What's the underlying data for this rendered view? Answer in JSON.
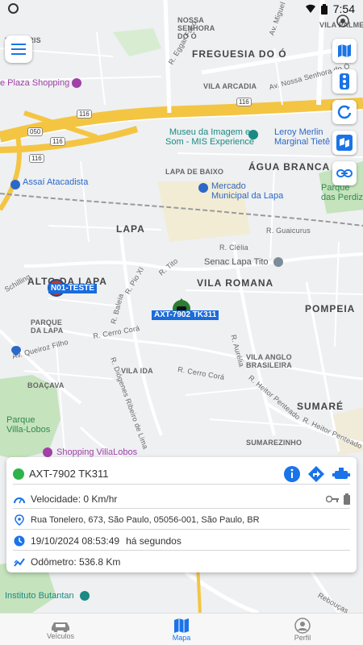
{
  "status_bar": {
    "time": "7:54"
  },
  "map": {
    "labels": {
      "freguesia": "FREGUESIA DO Ó",
      "agua_branca": "ÁGUA BRANCA",
      "lapa": "LAPA",
      "lapa_de_baixo": "LAPA DE BAIXO",
      "alto_da_lapa": "ALTO DA LAPA",
      "vila_romana": "VILA ROMANA",
      "pompeia": "POMPEIA",
      "parque_da_lapa": "PARQUE\nDA LAPA",
      "vila_ida": "VILA IDA",
      "vila_anglo": "VILA ANGLO\nBRASILEIRA",
      "boacava": "BOAÇAVA",
      "sumare": "SUMARÉ",
      "sumarezinho": "SUMAREZINHO",
      "vila_palmeira": "VILA PALME",
      "vila_arcadia": "VILA ARCADIA",
      "nossa_senhora": "NOSSA\nSENHORA\nDO Ó",
      "jardim_iris": "RDIM IRIS",
      "plaza_shopping": "e Plaza Shopping",
      "museu": "Museu da Imagem e\nSom - MIS Experience",
      "leroy": "Leroy Merlin\nMarginal Tietê",
      "assai": "Assaí Atacadista",
      "mercado": "Mercado\nMunicipal da Lapa",
      "senac": "Senac Lapa Tito",
      "parque_perdizes": "Parque\ndas Perdiz",
      "parque_villa_lobos": "Parque\nVilla-Lobos",
      "shopping_villalobos": "Shopping VillaLobos",
      "instituto": "Instituto Butantan",
      "rua_clelia": "R. Clélia",
      "rua_guaicurus": "R. Guaicurus",
      "rua_tito": "R. Tito",
      "rua_pio_xi": "R. Pio XI",
      "rua_cerro_cora": "R. Cerro Corá",
      "rua_cerro_cora2": "R. Cerro Corá",
      "rua_queiroz": "Av. Queiroz Filho",
      "rua_heitor": "R. Heitor Penteado",
      "rua_aurelia": "R. Aurélia",
      "rua_diogenes": "R. Diógenes Ribeiro de Lima",
      "rua_bauru": "R. Baleia",
      "rua_schilling": "Schilling",
      "rua_rebouças": "Rebouças",
      "rua_eggar": "R. Eggar Faco",
      "av_miguel": "Av. Miguel",
      "rua_nossa_senhora": "Av. Nossa Senhora do Ó",
      "rua_heitor2": "R. Heitor Penteado",
      "shield_116a": "116",
      "shield_116b": "116",
      "shield_050": "050",
      "shield_116c": "116",
      "shield_116d": "116"
    },
    "vehicles": [
      {
        "tag": "N01-TESTE"
      },
      {
        "tag": "AXT-7902 TK311"
      }
    ]
  },
  "toolbar": {
    "menu": "menu",
    "tools": [
      "map-icon",
      "traffic-icon",
      "refresh-icon",
      "layers-icon",
      "link-icon"
    ]
  },
  "vehicle_card": {
    "plate": "AXT-7902 TK311",
    "status_color": "#2db34a",
    "speed": "Velocidade: 0 Km/hr",
    "address": "Rua Tonelero, 673, São Paulo, 05056-001, São Paulo, BR",
    "datetime": "19/10/2024 08:53:49",
    "relative_time": "há segundos",
    "odometer": "Odômetro: 536.8 Km"
  },
  "bottom_nav": {
    "items": [
      {
        "label": "Veículos",
        "active": false
      },
      {
        "label": "Mapa",
        "active": true
      },
      {
        "label": "Perfil",
        "active": false
      }
    ]
  },
  "colors": {
    "accent": "#1a73e8",
    "expressway": "#f4c542",
    "water": "#9fc5e8",
    "park": "#b9ddb0"
  }
}
